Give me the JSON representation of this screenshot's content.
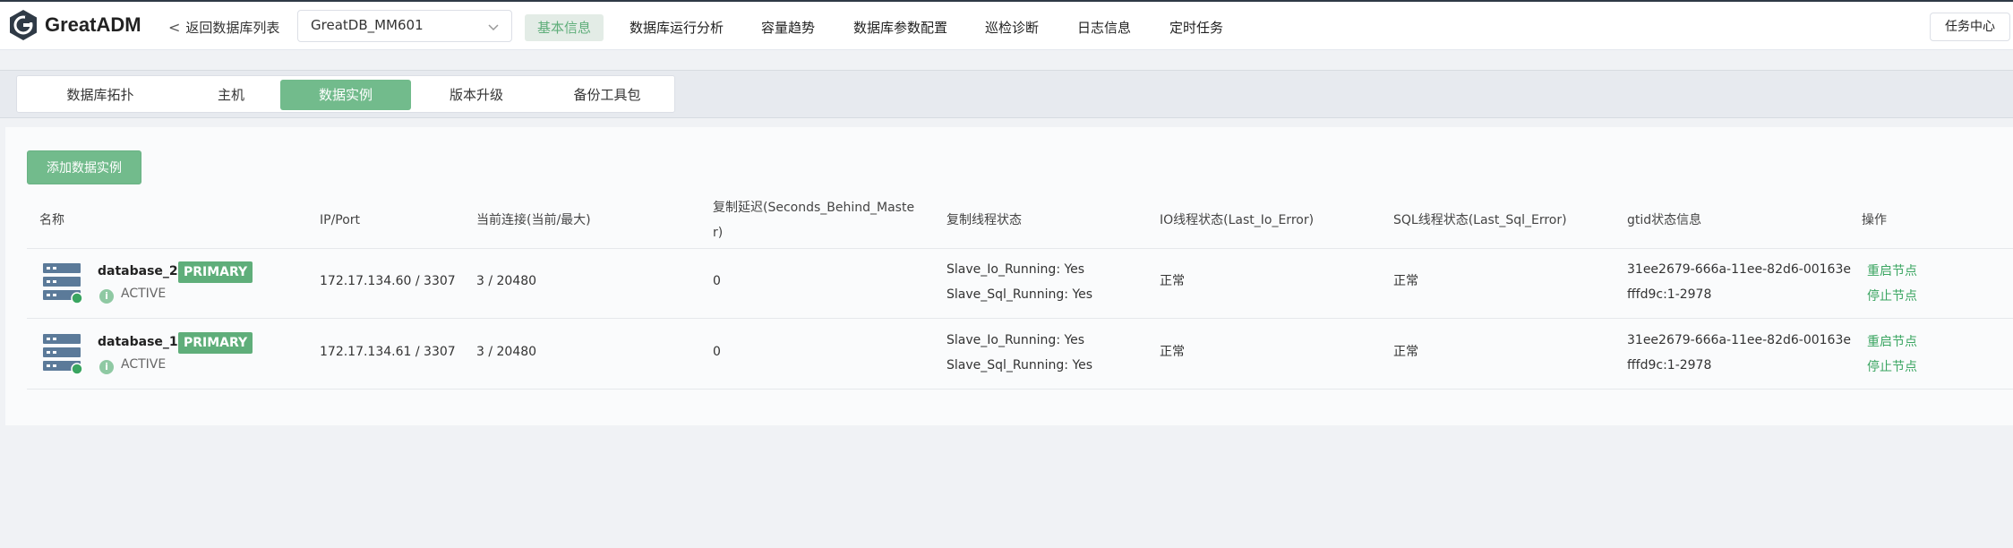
{
  "header": {
    "app_name": "GreatADM",
    "back_label": "返回数据库列表",
    "db_select": "GreatDB_MM601",
    "nav": [
      "基本信息",
      "数据库运行分析",
      "容量趋势",
      "数据库参数配置",
      "巡检诊断",
      "日志信息",
      "定时任务"
    ],
    "task_center": "任务中心"
  },
  "subtabs": [
    "数据库拓扑",
    "主机",
    "数据实例",
    "版本升级",
    "备份工具包"
  ],
  "actions": {
    "add_instance": "添加数据实例"
  },
  "table": {
    "headers": {
      "name": "名称",
      "ip_port": "IP/Port",
      "conn": "当前连接(当前/最大)",
      "delay_1": "复制延迟(Seconds_Behind_Maste",
      "delay_2": "r)",
      "repl": "复制线程状态",
      "io": "IO线程状态(Last_Io_Error)",
      "sql": "SQL线程状态(Last_Sql_Error)",
      "gtid": "gtid状态信息",
      "op": "操作"
    },
    "rows": [
      {
        "name": "database_2",
        "role": "PRIMARY",
        "status": "ACTIVE",
        "ip_port": "172.17.134.60 / 3307",
        "conn": "3 / 20480",
        "delay": "0",
        "io_running": "Slave_Io_Running: Yes",
        "sql_running": "Slave_Sql_Running: Yes",
        "io_state": "正常",
        "sql_state": "正常",
        "gtid_1": "31ee2679-666a-11ee-82d6-00163e",
        "gtid_2": "fffd9c:1-2978",
        "op_restart": "重启节点",
        "op_stop": "停止节点"
      },
      {
        "name": "database_1",
        "role": "PRIMARY",
        "status": "ACTIVE",
        "ip_port": "172.17.134.61 / 3307",
        "conn": "3 / 20480",
        "delay": "0",
        "io_running": "Slave_Io_Running: Yes",
        "sql_running": "Slave_Sql_Running: Yes",
        "io_state": "正常",
        "sql_state": "正常",
        "gtid_1": "31ee2679-666a-11ee-82d6-00163e",
        "gtid_2": "fffd9c:1-2978",
        "op_restart": "重启节点",
        "op_stop": "停止节点"
      }
    ]
  },
  "colors": {
    "accent": "#72bb8c",
    "accent_dark": "#5fae7a",
    "link": "#3aa561"
  }
}
